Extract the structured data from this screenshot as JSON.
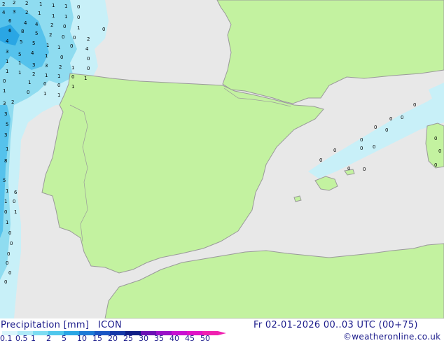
{
  "title": "Precipitation [mm]",
  "model": "ICON",
  "valid_time": "Fr 02-01-2026 00..03 UTC (00+75)",
  "credit": "©weatheronline.co.uk",
  "legend": {
    "ticks": [
      "0.1",
      "0.5",
      "1",
      "2",
      "5",
      "10",
      "15",
      "20",
      "25",
      "30",
      "35",
      "40",
      "45",
      "50"
    ],
    "colors": [
      "#d8f5fb",
      "#aeeaf7",
      "#7ddcf2",
      "#4fc7ec",
      "#2aa6e4",
      "#1e7bd6",
      "#1a56c4",
      "#1538a8",
      "#101e86",
      "#6a10b4",
      "#9a10c8",
      "#c810d2",
      "#e012c6",
      "#f020b0"
    ]
  },
  "colors": {
    "sea": "#e8e8e8",
    "land": "#c3f2a0",
    "coast": "#9a9a9a",
    "light_precip": "#c8f0f8",
    "medium_precip": "#8fdcf0",
    "heavy_precip": "#55c2ec"
  },
  "precip_values": [
    "2",
    "2",
    "2",
    "1",
    "1",
    "1",
    "0",
    "4",
    "3",
    "2",
    "1",
    "1",
    "1",
    "0",
    "6",
    "4",
    "4",
    "2",
    "0",
    "1",
    "0",
    "6",
    "8",
    "5",
    "2",
    "0",
    "0",
    "2",
    "4",
    "5",
    "5",
    "1",
    "1",
    "0",
    "4",
    "3",
    "5",
    "4",
    "1",
    "0",
    "0",
    "1",
    "1",
    "3",
    "3",
    "2",
    "1",
    "0",
    "1",
    "1",
    "2",
    "1",
    "1",
    "0",
    "1",
    "0",
    "1",
    "0",
    "0",
    "1",
    "1",
    "0",
    "1",
    "1",
    "2",
    "3",
    "3",
    "5",
    "3",
    "1",
    "8",
    "5",
    "1",
    "6",
    "1",
    "0",
    "0",
    "1",
    "1",
    "0",
    "0",
    "0",
    "0",
    "0",
    "0",
    "0",
    "0",
    "0",
    "0",
    "0",
    "0",
    "0",
    "0",
    "0",
    "0",
    "0",
    "0",
    "0",
    "0",
    "0",
    "0"
  ]
}
